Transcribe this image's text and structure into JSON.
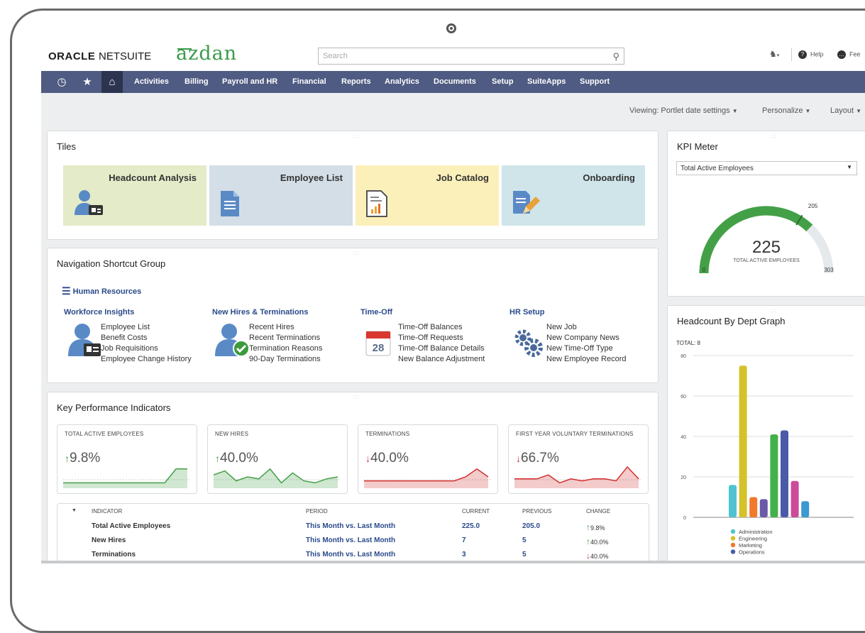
{
  "header": {
    "logo_oracle": "ORACLE",
    "logo_netsuite": "NETSUITE",
    "logo_azdan": "azdan",
    "search_placeholder": "Search",
    "help_label": "Help",
    "feedback_label": "Fee"
  },
  "nav": {
    "items": [
      "Activities",
      "Billing",
      "Payroll and HR",
      "Financial",
      "Reports",
      "Analytics",
      "Documents",
      "Setup",
      "SuiteApps",
      "Support"
    ]
  },
  "viewbar": {
    "viewing": "Viewing: Portlet date settings",
    "personalize": "Personalize",
    "layout": "Layout"
  },
  "tiles": {
    "title": "Tiles",
    "items": [
      {
        "label": "Headcount Analysis",
        "bg": "#e4ebc8",
        "icon": "person-card-icon"
      },
      {
        "label": "Employee List",
        "bg": "#d3dee7",
        "icon": "document-icon"
      },
      {
        "label": "Job Catalog",
        "bg": "#fbf0b9",
        "icon": "report-icon"
      },
      {
        "label": "Onboarding",
        "bg": "#d0e5ea",
        "icon": "edit-document-icon"
      }
    ]
  },
  "shortcuts": {
    "title": "Navigation Shortcut Group",
    "group": "Human Resources",
    "sections": [
      {
        "title": "Workforce Insights",
        "links": [
          "Employee List",
          "Benefit Costs",
          "Job Requisitions",
          "Employee Change History"
        ]
      },
      {
        "title": "New Hires & Terminations",
        "links": [
          "Recent Hires",
          "Recent Terminations",
          "Termination Reasons",
          "90-Day Terminations"
        ]
      },
      {
        "title": "Time-Off",
        "links": [
          "Time-Off Balances",
          "Time-Off Requests",
          "Time-Off Balance Details",
          "New Balance Adjustment"
        ],
        "calendar_day": "28"
      },
      {
        "title": "HR Setup",
        "links": [
          "New Job",
          "New Company News",
          "New Time-Off Type",
          "New Employee Record"
        ]
      }
    ]
  },
  "kpis": {
    "title": "Key Performance Indicators",
    "boxes": [
      {
        "name": "TOTAL ACTIVE EMPLOYEES",
        "arrow": "↑",
        "value": "9.8%",
        "dir": "up",
        "color": "#43a047",
        "spark": [
          2,
          2,
          2,
          2,
          2,
          2,
          2,
          2,
          2,
          2,
          9,
          9
        ]
      },
      {
        "name": "NEW HIRES",
        "arrow": "↑",
        "value": "40.0%",
        "dir": "up",
        "color": "#43a047",
        "spark": [
          6,
          8,
          3,
          5,
          4,
          9,
          2,
          7,
          3,
          2,
          4,
          5
        ]
      },
      {
        "name": "TERMINATIONS",
        "arrow": "↓",
        "value": "40.0%",
        "dir": "down",
        "color": "#d32f2f",
        "spark": [
          3,
          3,
          3,
          3,
          3,
          3,
          3,
          3,
          3,
          5,
          9,
          5
        ]
      },
      {
        "name": "FIRST YEAR VOLUNTARY TERMINATIONS",
        "arrow": "↓",
        "value": "66.7%",
        "dir": "down",
        "color": "#d32f2f",
        "spark": [
          4,
          4,
          4,
          6,
          2,
          4,
          3,
          4,
          4,
          3,
          10,
          4
        ]
      }
    ],
    "table": {
      "headers": [
        "INDICATOR",
        "PERIOD",
        "CURRENT",
        "PREVIOUS",
        "CHANGE"
      ],
      "rows": [
        {
          "indicator": "Total Active Employees",
          "period": "This Month vs. Last Month",
          "current": "225.0",
          "previous": "205.0",
          "arrow": "↑",
          "change": "9.8%",
          "dir": "up"
        },
        {
          "indicator": "New Hires",
          "period": "This Month vs. Last Month",
          "current": "7",
          "previous": "5",
          "arrow": "↑",
          "change": "40.0%",
          "dir": "up"
        },
        {
          "indicator": "Terminations",
          "period": "This Month vs. Last Month",
          "current": "3",
          "previous": "5",
          "arrow": "↓",
          "change": "40.0%",
          "dir": "down"
        }
      ]
    }
  },
  "kpi_meter": {
    "title": "KPI Meter",
    "selected": "Total Active Employees",
    "value": "225",
    "caption": "TOTAL ACTIVE EMPLOYEES",
    "min": "0",
    "max": "303",
    "target": "205",
    "value_num": 225,
    "min_num": 0,
    "max_num": 303,
    "target_num": 205
  },
  "headcount": {
    "title": "Headcount By Dept Graph",
    "total": "TOTAL: 8"
  },
  "chart_data": {
    "type": "bar",
    "categories": [
      "",
      "",
      "",
      "",
      "",
      "",
      "",
      ""
    ],
    "values": [
      16,
      75,
      10,
      9,
      41,
      43,
      18,
      8
    ],
    "colors": [
      "#4fc3d1",
      "#d4c22a",
      "#f07a2a",
      "#6a5aa8",
      "#43b04a",
      "#4a5aa8",
      "#cc4a9a",
      "#3a9ad0"
    ],
    "ylim": [
      0,
      80
    ],
    "yticks": [
      "0",
      "20",
      "40",
      "60",
      "80"
    ],
    "legend": [
      {
        "name": "Administration",
        "color": "#4fc3d1"
      },
      {
        "name": "Engineering",
        "color": "#d4c22a"
      },
      {
        "name": "Marketing",
        "color": "#f07a2a"
      },
      {
        "name": "Operations",
        "color": "#4a5aa8"
      }
    ]
  }
}
